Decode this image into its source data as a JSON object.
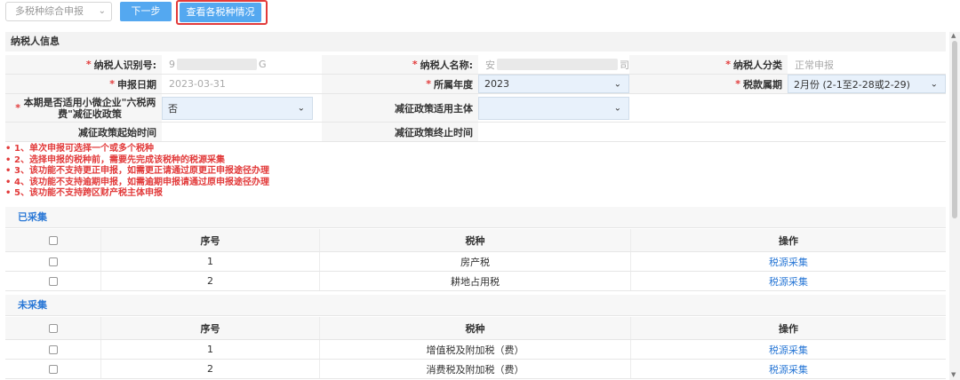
{
  "toolbar": {
    "declaration_select": "多税种综合申报",
    "next_button": "下一步",
    "view_button": "查看各税种情况"
  },
  "info": {
    "section_title": "纳税人信息",
    "taxpayer_id_label": "纳税人识别号:",
    "taxpayer_id_prefix": "9",
    "taxpayer_id_suffix": "G",
    "taxpayer_name_label": "纳税人名称:",
    "taxpayer_name_prefix": "安",
    "taxpayer_name_suffix": "司",
    "taxpayer_category_label": "纳税人分类",
    "taxpayer_category_value": "正常申报",
    "declare_date_label": "申报日期",
    "declare_date_value": "2023-03-31",
    "year_label": "所属年度",
    "year_value": "2023",
    "period_label": "税款属期",
    "period_value": "2月份 (2-1至2-28或2-29)",
    "small_business_label": "本期是否适用小微企业\"六税两费\"减征收政策",
    "small_business_value": "否",
    "reduction_subject_label": "减征政策适用主体",
    "reduction_subject_value": "",
    "reduction_start_label": "减征政策起始时间",
    "reduction_end_label": "减征政策终止时间"
  },
  "notes": [
    "1、单次申报可选择一个或多个税种",
    "2、选择申报的税种前，需要先完成该税种的税源采集",
    "3、该功能不支持更正申报，如需更正请通过原更正申报途径办理",
    "4、该功能不支持逾期申报，如需逾期申报请通过原申报途径办理",
    "5、该功能不支持跨区财产税主体申报"
  ],
  "collected": {
    "title": "已采集",
    "headers": [
      "序号",
      "税种",
      "操作"
    ],
    "rows": [
      {
        "no": "1",
        "tax": "房产税",
        "action": "税源采集"
      },
      {
        "no": "2",
        "tax": "耕地占用税",
        "action": "税源采集"
      }
    ]
  },
  "uncollected": {
    "title": "未采集",
    "headers": [
      "序号",
      "税种",
      "操作"
    ],
    "rows": [
      {
        "no": "1",
        "tax": "增值税及附加税（费）",
        "action": "税源采集"
      },
      {
        "no": "2",
        "tax": "消费税及附加税（费）",
        "action": "税源采集"
      }
    ]
  },
  "colors": {
    "accent": "#54a8f0",
    "highlight": "#e23a3a",
    "link": "#2a78d6"
  }
}
